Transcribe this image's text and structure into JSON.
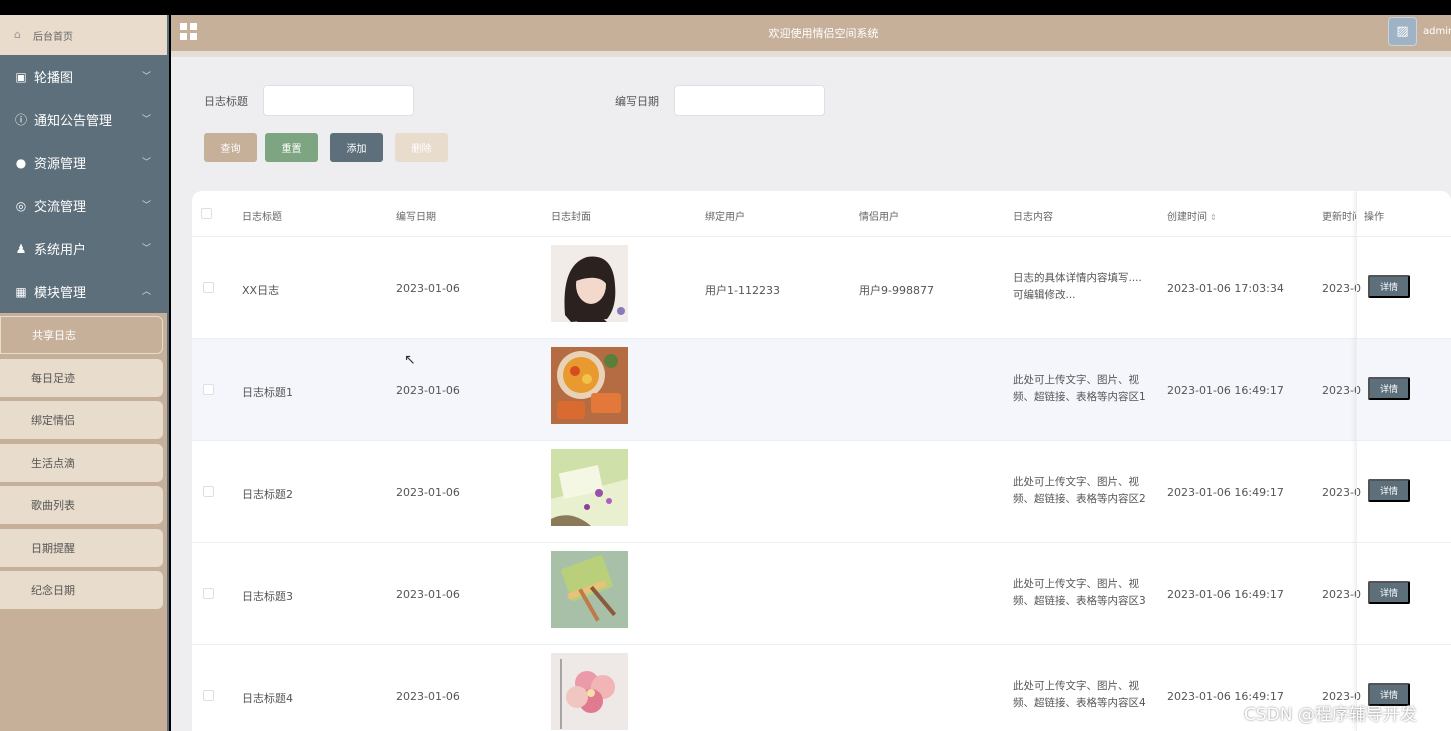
{
  "sidebar": {
    "home_label": "后台首页",
    "menu": [
      {
        "label": "轮播图",
        "icon": "image-icon"
      },
      {
        "label": "通知公告管理",
        "icon": "info-icon"
      },
      {
        "label": "资源管理",
        "icon": "bulb-icon"
      },
      {
        "label": "交流管理",
        "icon": "chat-icon"
      },
      {
        "label": "系统用户",
        "icon": "user-icon"
      },
      {
        "label": "模块管理",
        "icon": "grid-icon"
      }
    ],
    "submenu": [
      "共享日志",
      "每日足迹",
      "绑定情侣",
      "生活点滴",
      "歌曲列表",
      "日期提醒",
      "纪念日期"
    ],
    "active_submenu": "共享日志"
  },
  "header": {
    "title": "欢迎使用情侣空间系统",
    "user": "admin"
  },
  "search": {
    "title_label": "日志标题",
    "date_label": "编写日期",
    "title_value": "",
    "date_value": ""
  },
  "buttons": {
    "query": "查询",
    "reset": "重置",
    "add": "添加",
    "delete": "删除"
  },
  "table": {
    "columns": [
      "日志标题",
      "编写日期",
      "日志封面",
      "绑定用户",
      "情侣用户",
      "日志内容",
      "创建时间",
      "更新时间",
      "操作"
    ],
    "detail_label": "详情",
    "rows": [
      {
        "title": "XX日志",
        "date": "2023-01-06",
        "bound_user": "用户1-112233",
        "partner_user": "用户9-998877",
        "content_1": "日志的具体详情内容填写....",
        "content_2": "可编辑修改...",
        "created": "2023-01-06 17:03:34",
        "updated": "2023-0"
      },
      {
        "title": "日志标题1",
        "date": "2023-01-06",
        "bound_user": "",
        "partner_user": "",
        "content_1": "此处可上传文字、图片、视",
        "content_2": "频、超链接、表格等内容区1",
        "created": "2023-01-06 16:49:17",
        "updated": "2023-0"
      },
      {
        "title": "日志标题2",
        "date": "2023-01-06",
        "bound_user": "",
        "partner_user": "",
        "content_1": "此处可上传文字、图片、视",
        "content_2": "频、超链接、表格等内容区2",
        "created": "2023-01-06 16:49:17",
        "updated": "2023-0"
      },
      {
        "title": "日志标题3",
        "date": "2023-01-06",
        "bound_user": "",
        "partner_user": "",
        "content_1": "此处可上传文字、图片、视",
        "content_2": "频、超链接、表格等内容区3",
        "created": "2023-01-06 16:49:17",
        "updated": "2023-0"
      },
      {
        "title": "日志标题4",
        "date": "2023-01-06",
        "bound_user": "",
        "partner_user": "",
        "content_1": "此处可上传文字、图片、视",
        "content_2": "频、超链接、表格等内容区4",
        "created": "2023-01-06 16:49:17",
        "updated": "2023-0"
      }
    ]
  },
  "watermark": "CSDN @程序辅导开发",
  "colors": {
    "accent": "#c7b09a",
    "sidebar_menu": "#5c6f7b",
    "reset_button": "#7da581",
    "submenu_bg": "#e8dccc"
  }
}
